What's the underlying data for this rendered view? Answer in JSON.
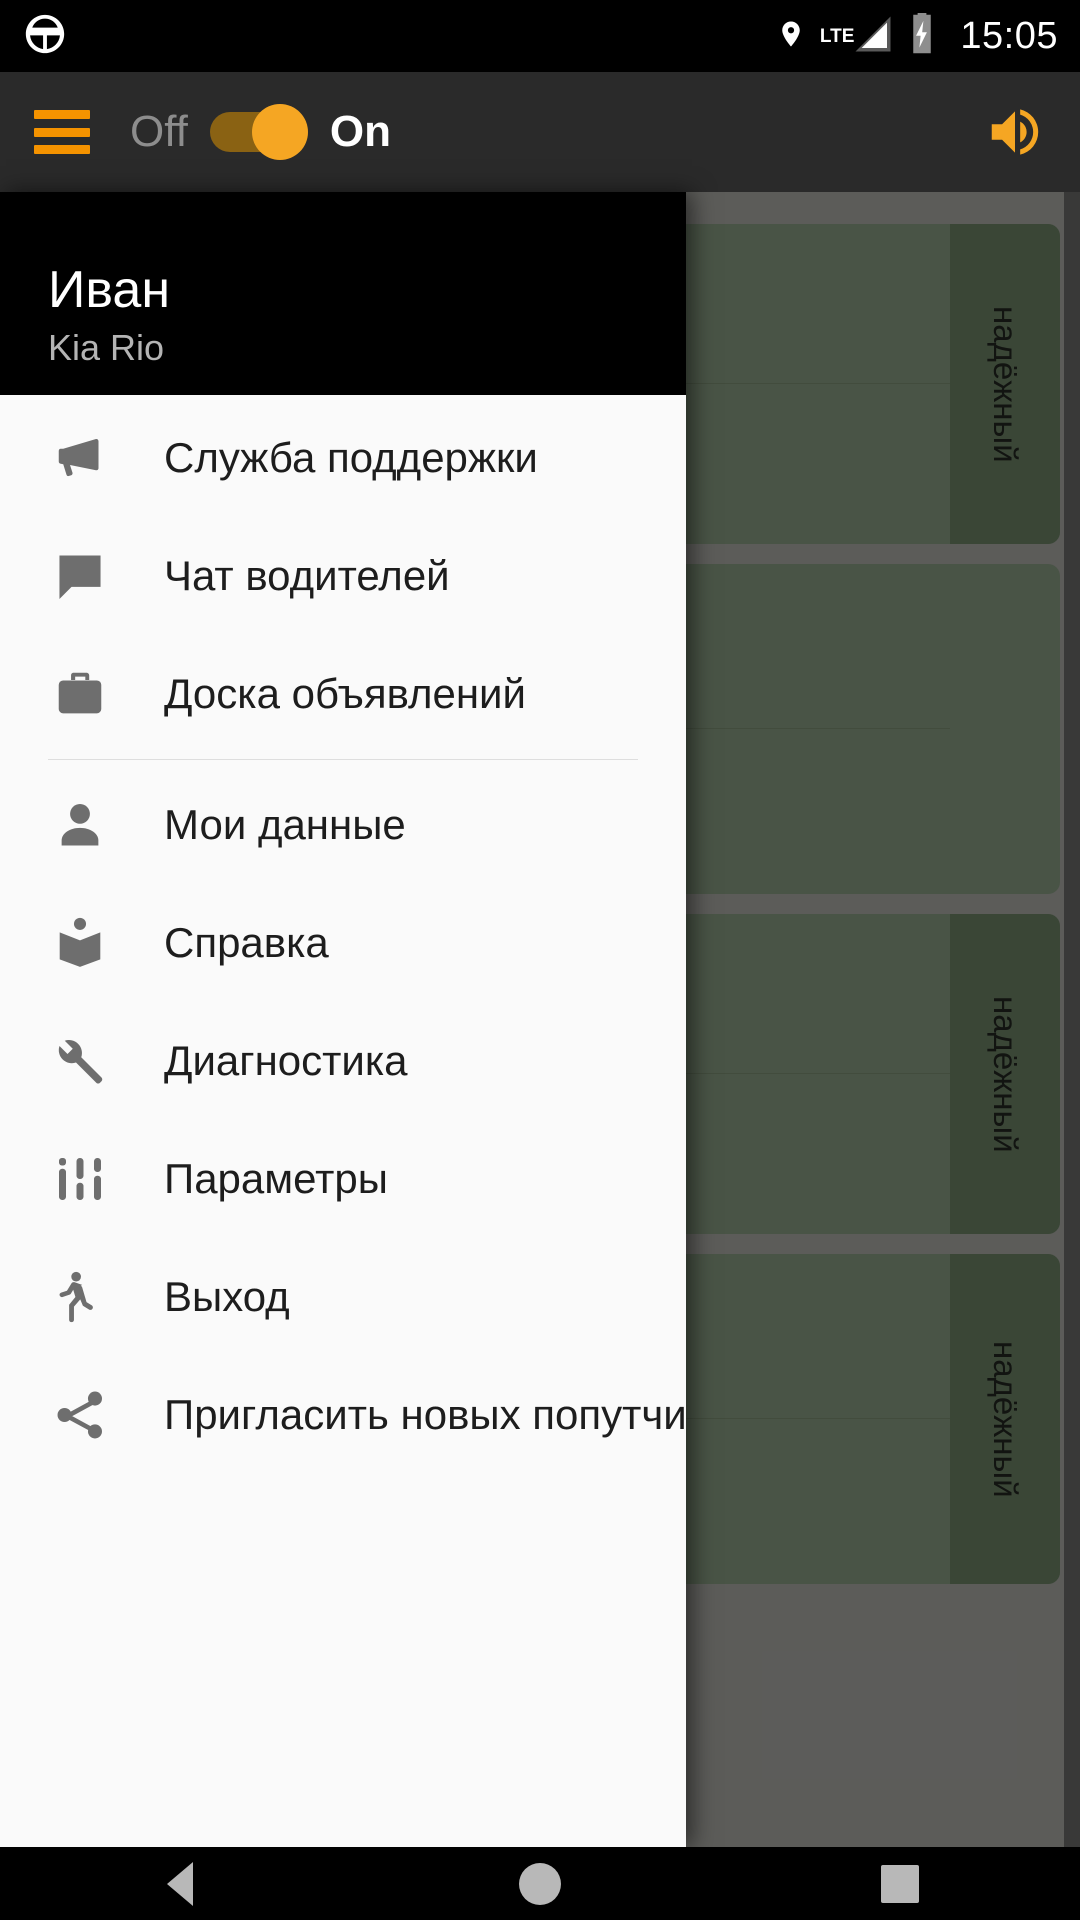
{
  "status_bar": {
    "app_icon": "steering-wheel-icon",
    "location_icon": "location-pin-icon",
    "network_label": "LTE",
    "signal_icon": "signal-bars-icon",
    "battery_icon": "battery-charging-icon",
    "time": "15:05"
  },
  "app_bar": {
    "menu_icon": "hamburger-menu-icon",
    "off_label": "Off",
    "on_label": "On",
    "toggle_state": "on",
    "volume_icon": "volume-up-icon",
    "accent_color": "#f5a623",
    "background_color": "#2a2a2a"
  },
  "drawer": {
    "header": {
      "name": "Иван",
      "vehicle": "Kia Rio"
    },
    "items": [
      {
        "label": "Служба поддержки",
        "icon": "megaphone-icon"
      },
      {
        "label": "Чат водителей",
        "icon": "chat-bubble-icon"
      },
      {
        "label": "Доска объявлений",
        "icon": "briefcase-icon"
      },
      {
        "label": "Мои данные",
        "icon": "person-icon"
      },
      {
        "label": "Справка",
        "icon": "open-book-icon"
      },
      {
        "label": "Диагностика",
        "icon": "wrench-icon"
      },
      {
        "label": "Параметры",
        "icon": "tune-sliders-icon"
      },
      {
        "label": "Выход",
        "icon": "running-exit-icon"
      },
      {
        "label": "Пригласить новых попутчиков",
        "icon": "share-icon"
      }
    ],
    "divider_after_index": 2
  },
  "background": {
    "cards": [
      {
        "badge": "надёжный",
        "has_badge": true
      },
      {
        "badge": "",
        "has_badge": false
      },
      {
        "badge": "надёжный",
        "has_badge": true
      },
      {
        "badge": "надёжный",
        "has_badge": true
      }
    ],
    "card_color": "#60705c",
    "badge_color": "#4b5c46"
  },
  "nav_bar": {
    "back": "back-button",
    "home": "home-button",
    "recents": "recents-button"
  }
}
